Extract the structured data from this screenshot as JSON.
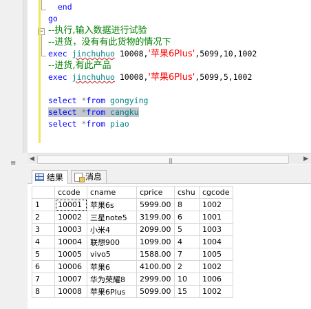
{
  "editor": {
    "lines": {
      "end": "end",
      "go": "go",
      "c1": "--执行,输入数据进行试验",
      "c2": "--进货，没有有此货物的情况下",
      "exec1": {
        "kw": "exec",
        "fn": "jinchuhuo",
        "a": " 10008,",
        "s": "'苹果6Plus'",
        "b": ",5099,10,1002"
      },
      "c3": "--进货,有此产品",
      "exec2": {
        "kw": "exec",
        "fn": "jinchuhuo",
        "a": " 10008,",
        "s": "'苹果6Plus'",
        "b": ",5099,5,1002"
      },
      "sel1": {
        "kw1": "select",
        "star": " *",
        "kw2": "from",
        "obj": "gongying"
      },
      "sel2": {
        "kw1": "select",
        "star": " *",
        "kw2": "from",
        "obj": "cangku"
      },
      "sel3": {
        "kw1": "select",
        "star": " *",
        "kw2": "from",
        "obj": "piao"
      }
    },
    "fold_plus": "−"
  },
  "tabs": {
    "results": "结果",
    "messages": "消息"
  },
  "grid": {
    "columns": [
      "ccode",
      "cname",
      "cprice",
      "cshu",
      "cgcode"
    ],
    "rows": [
      [
        "1",
        "10001",
        "苹果6s",
        "5999.00",
        "8",
        "1002"
      ],
      [
        "2",
        "10002",
        "三星note5",
        "3199.00",
        "6",
        "1001"
      ],
      [
        "3",
        "10003",
        "小米4",
        "2099.00",
        "5",
        "1003"
      ],
      [
        "4",
        "10004",
        "联想900",
        "1099.00",
        "4",
        "1004"
      ],
      [
        "5",
        "10005",
        "vivo5",
        "1588.00",
        "7",
        "1005"
      ],
      [
        "6",
        "10006",
        "苹果6",
        "4100.00",
        "2",
        "1002"
      ],
      [
        "7",
        "10007",
        "华为荣耀8",
        "2999.00",
        "10",
        "1006"
      ],
      [
        "8",
        "10008",
        "苹果6Plus",
        "5099.00",
        "15",
        "1002"
      ]
    ]
  },
  "colors": {
    "keyword": "#0000ff",
    "comment": "#008000",
    "string": "#ff0000",
    "object": "#008080",
    "selection": "#c3c7cf"
  }
}
